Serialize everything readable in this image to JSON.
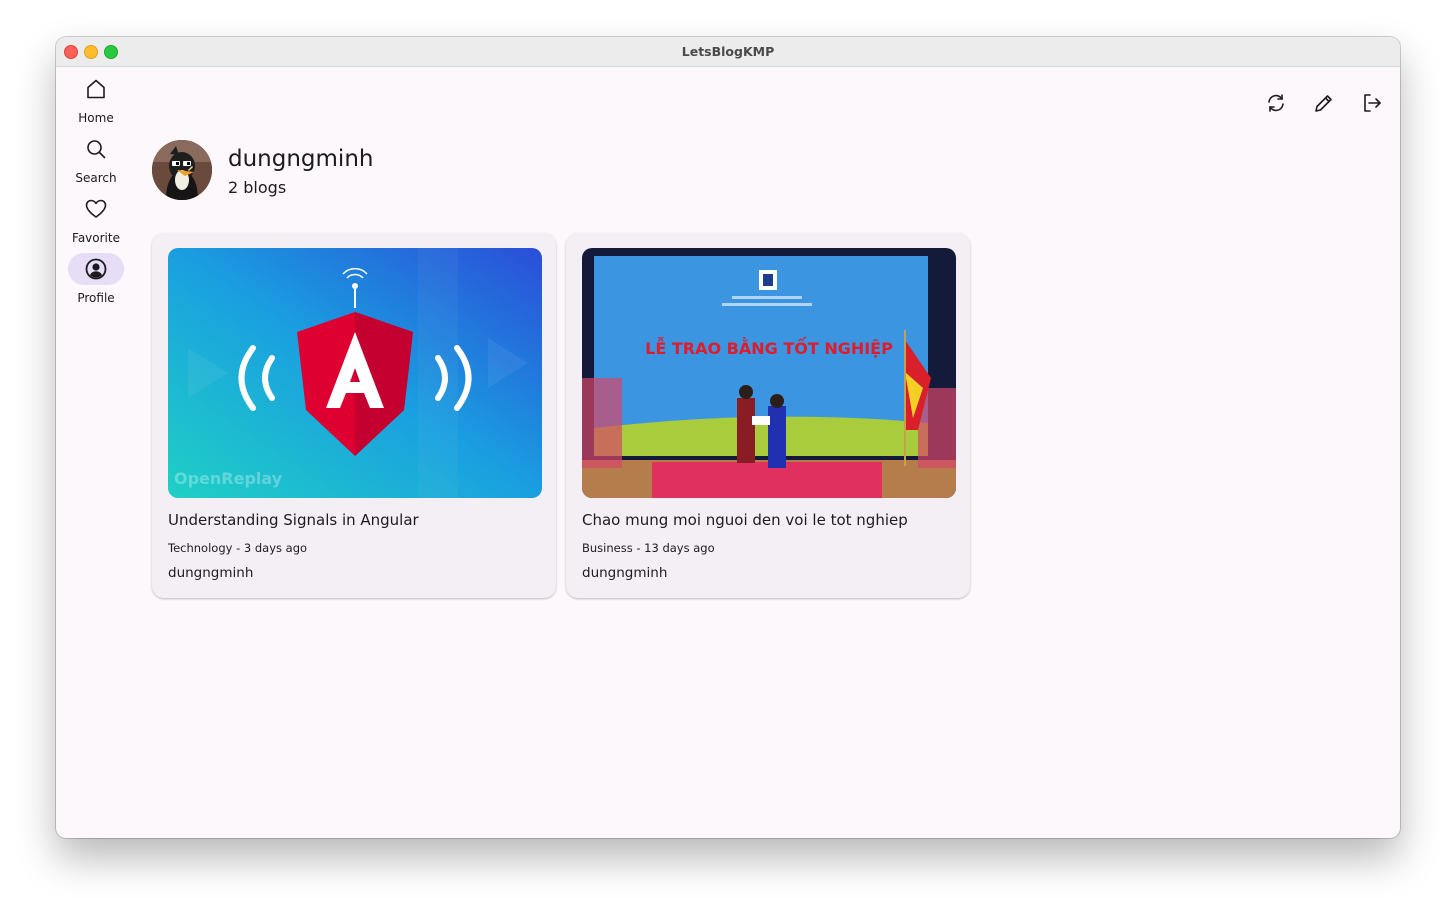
{
  "window": {
    "title": "LetsBlogKMP"
  },
  "sidebar": {
    "items": [
      {
        "label": "Home",
        "icon": "home-icon",
        "active": false
      },
      {
        "label": "Search",
        "icon": "search-icon",
        "active": false
      },
      {
        "label": "Favorite",
        "icon": "heart-icon",
        "active": false
      },
      {
        "label": "Profile",
        "icon": "account-circle-icon",
        "active": true
      }
    ]
  },
  "toolbar": {
    "actions": [
      {
        "icon": "refresh-icon"
      },
      {
        "icon": "edit-pencil-icon"
      },
      {
        "icon": "logout-icon"
      }
    ]
  },
  "profile": {
    "username": "dungngminh",
    "blog_count": "2 blogs"
  },
  "blogs": [
    {
      "title": "Understanding Signals in Angular",
      "meta": "Technology - 3 days ago",
      "author": "dungngminh",
      "image_text": "OpenReplay"
    },
    {
      "title": "Chao mung moi nguoi den voi le tot nghiep",
      "meta": "Business - 13 days ago",
      "author": "dungngminh",
      "image_text": "LỄ TRAO BẰNG TỐT NGHIỆP"
    }
  ],
  "colors": {
    "background": "#fdf8fc",
    "card": "#f4eff5",
    "active_pill": "#e6ddf6",
    "text": "#1c1b1f",
    "angular_red": "#dd0031"
  }
}
